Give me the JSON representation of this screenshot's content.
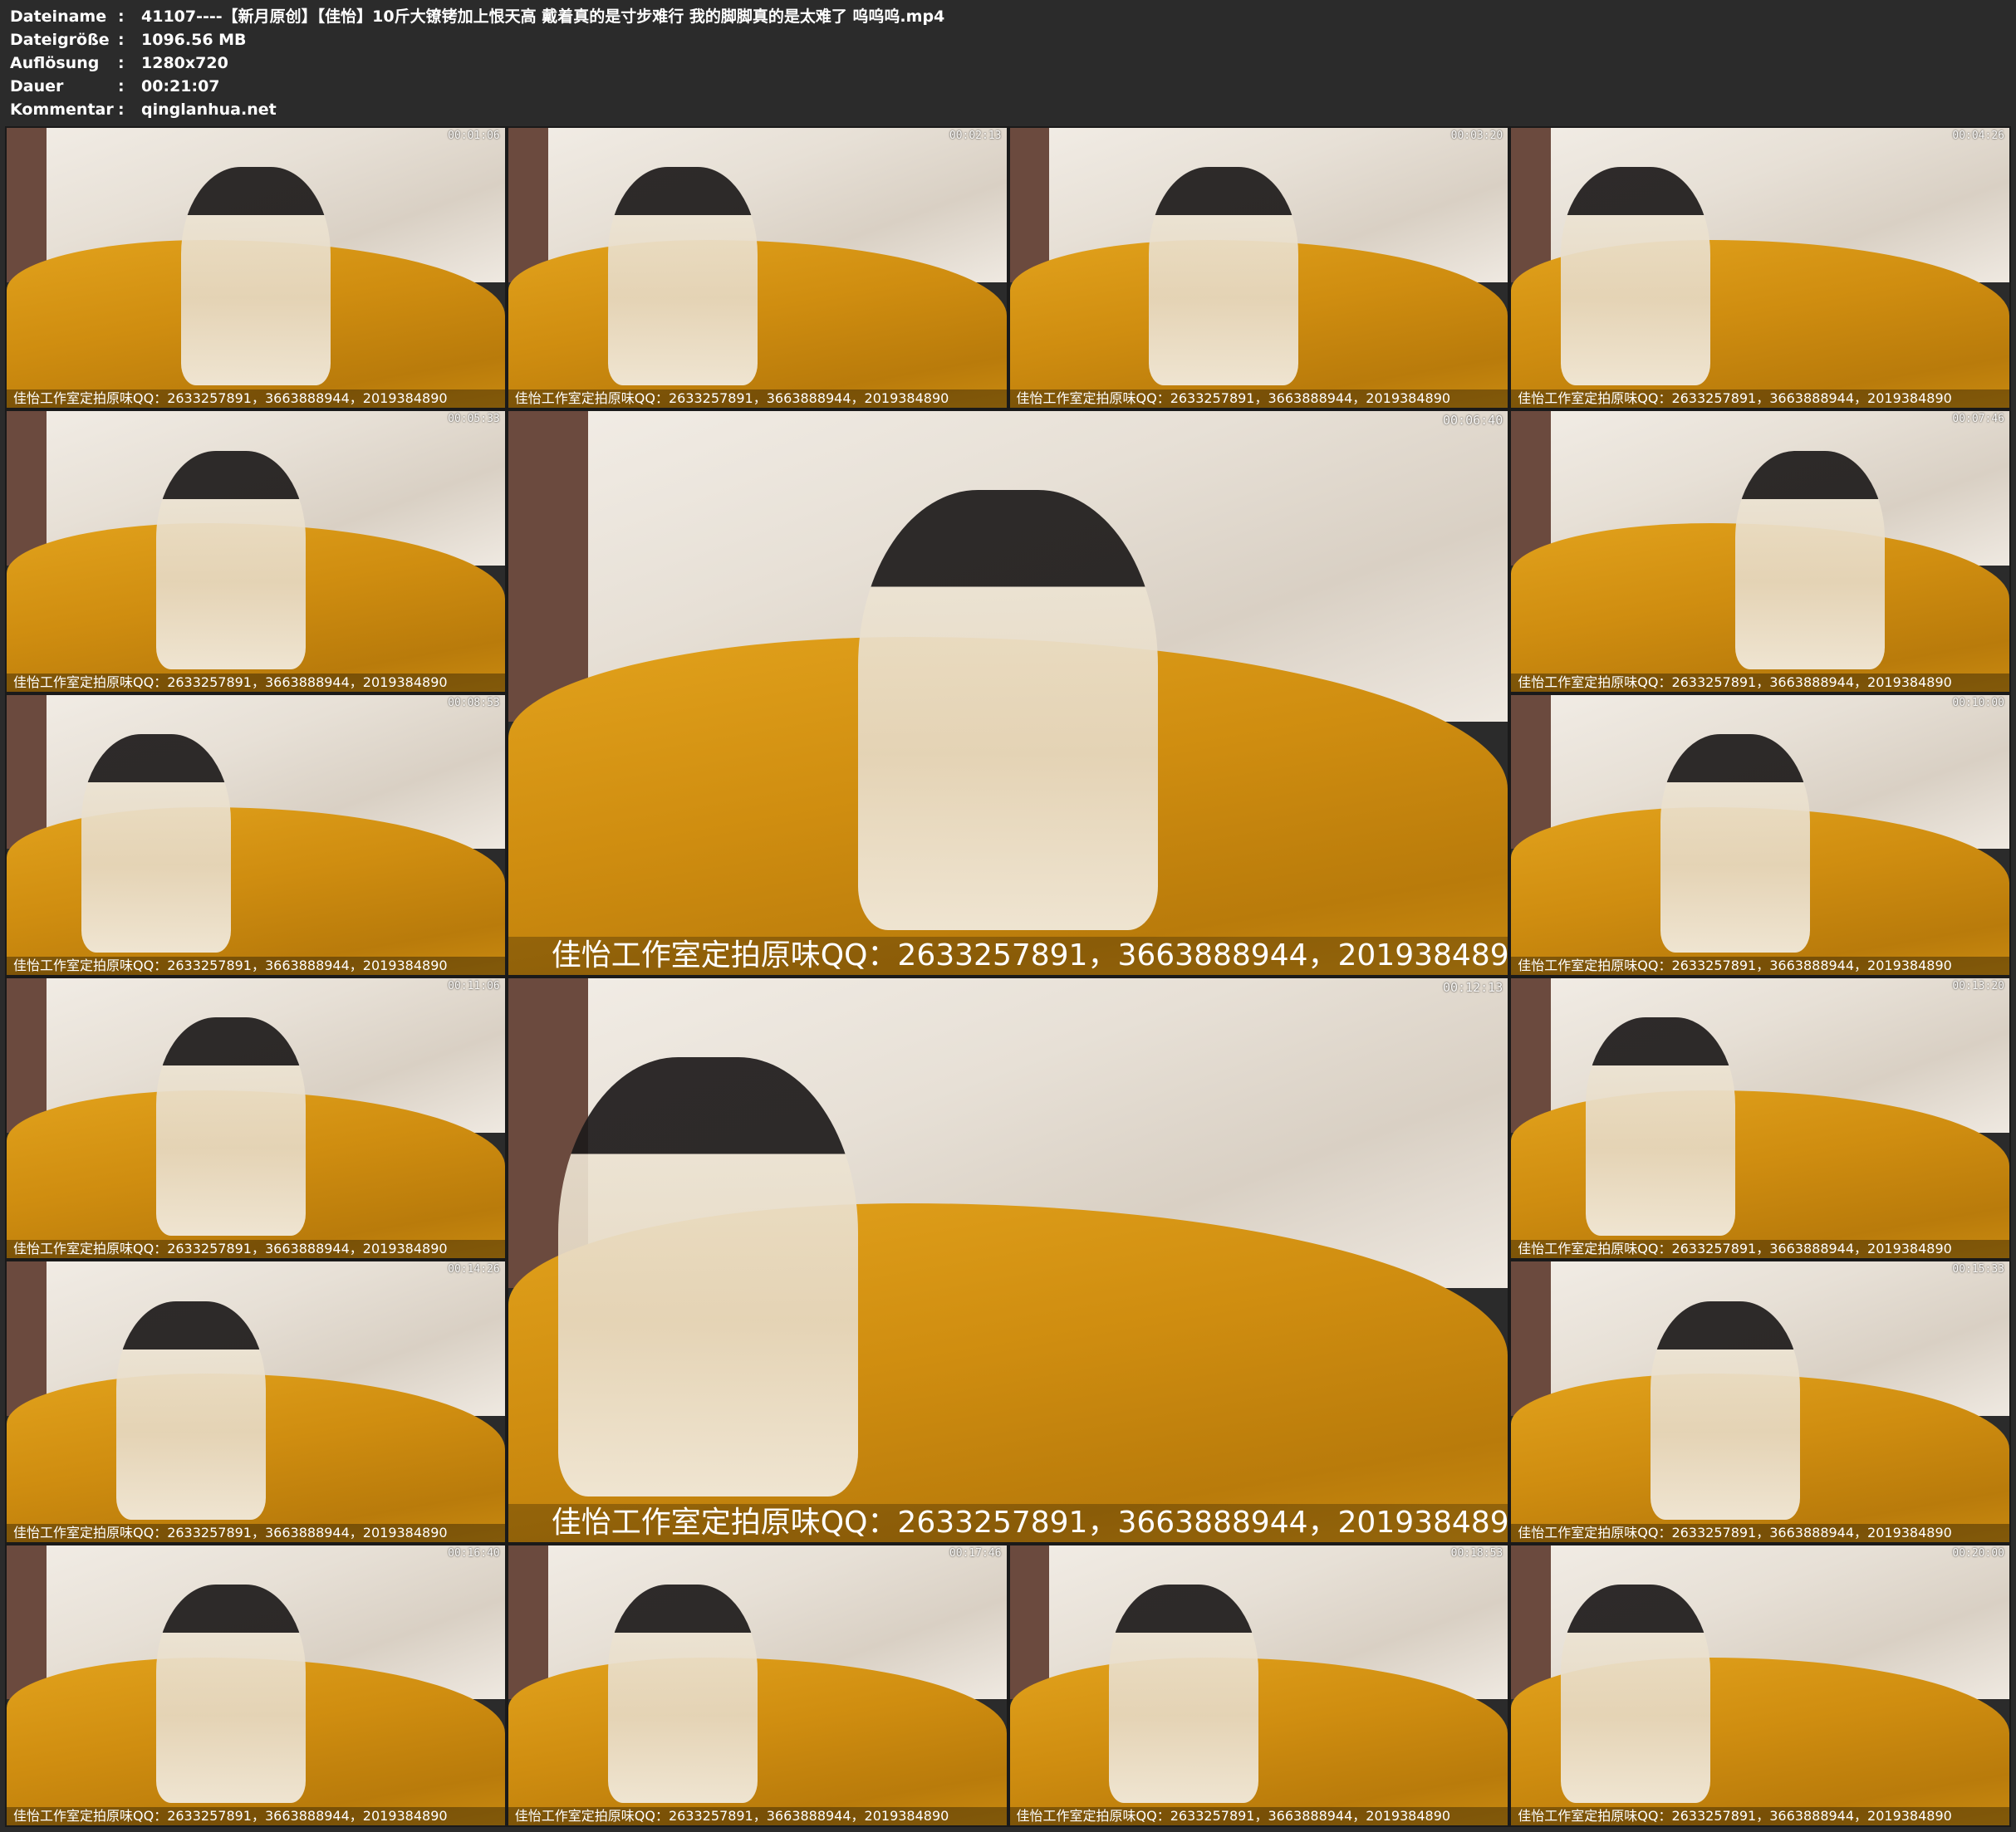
{
  "header": {
    "rows": [
      {
        "label": "Dateiname",
        "value": "41107----【新月原创】【佳怡】10斤大镣铐加上恨天高 戴着真的是寸步难行 我的脚脚真的是太难了 呜呜呜.mp4"
      },
      {
        "label": "Dateigröße",
        "value": "1096.56 MB"
      },
      {
        "label": "Auflösung",
        "value": "1280x720"
      },
      {
        "label": "Dauer",
        "value": "00:21:07"
      },
      {
        "label": "Kommentar",
        "value": "qinglanhua.net"
      }
    ],
    "separator": ":"
  },
  "watermark": "佳怡工作室定拍原味QQ：2633257891，3663888944，2019384890",
  "thumbnails": [
    {
      "time": "00:01:06"
    },
    {
      "time": "00:02:13"
    },
    {
      "time": "00:03:20"
    },
    {
      "time": "00:04:26"
    },
    {
      "time": "00:05:33"
    },
    {
      "time": "00:06:40"
    },
    {
      "time": "00:07:46"
    },
    {
      "time": "00:08:53"
    },
    {
      "time": "00:10:00"
    },
    {
      "time": "00:11:06"
    },
    {
      "time": "00:12:13"
    },
    {
      "time": "00:13:20"
    },
    {
      "time": "00:14:26"
    },
    {
      "time": "00:15:33"
    },
    {
      "time": "00:16:40"
    },
    {
      "time": "00:17:46"
    },
    {
      "time": "00:18:53"
    },
    {
      "time": "00:20:00"
    }
  ]
}
